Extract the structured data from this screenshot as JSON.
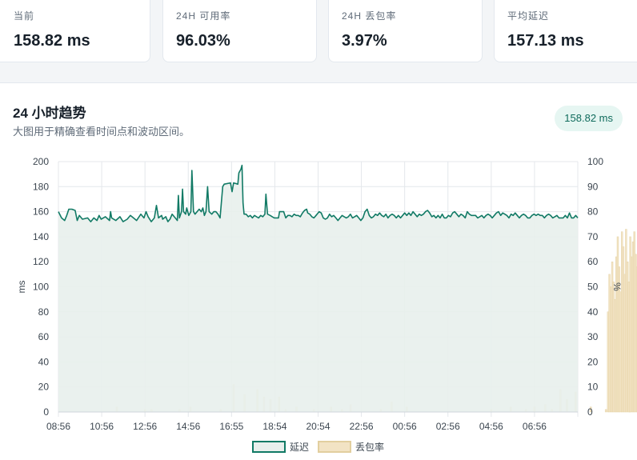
{
  "stats": [
    {
      "label": "当前",
      "value": "158.82 ms"
    },
    {
      "label": "24H 可用率",
      "value": "96.03%"
    },
    {
      "label": "24H 丢包率",
      "value": "3.97%"
    },
    {
      "label": "平均延迟",
      "value": "157.13 ms"
    }
  ],
  "trend": {
    "title": "24 小时趋势",
    "subtitle": "大图用于精确查看时间点和波动区间。",
    "current_badge": "158.82 ms"
  },
  "colors": {
    "latency": "#117a65",
    "latency_fill": "#e8efec",
    "loss": "#f2e3c4",
    "loss_stroke": "#e2cf9f"
  },
  "chart_data": {
    "type": "line",
    "x_ticks": [
      "08:56",
      "10:56",
      "12:56",
      "14:56",
      "16:55",
      "18:54",
      "20:54",
      "22:56",
      "00:56",
      "02:56",
      "04:56",
      "06:56"
    ],
    "y_left": {
      "label": "ms",
      "min": 0,
      "max": 200,
      "ticks": [
        0,
        20,
        40,
        60,
        80,
        100,
        120,
        140,
        160,
        180,
        200
      ]
    },
    "y_right": {
      "label": "%",
      "min": 0,
      "max": 100,
      "ticks": [
        0,
        10,
        20,
        30,
        40,
        50,
        60,
        70,
        80,
        90,
        100
      ]
    },
    "legend": {
      "position": "bottom",
      "items": [
        "延迟",
        "丢包率"
      ]
    },
    "grid": true,
    "x_hours_span": 24,
    "series": [
      {
        "name": "延迟",
        "axis": "left",
        "style": "line-area",
        "points": [
          [
            0,
            160
          ],
          [
            0.3,
            155
          ],
          [
            0.6,
            153
          ],
          [
            0.8,
            157
          ],
          [
            1.0,
            162
          ],
          [
            1.3,
            162
          ],
          [
            1.6,
            161
          ],
          [
            1.8,
            153
          ],
          [
            2.0,
            157
          ],
          [
            2.3,
            154
          ],
          [
            2.8,
            155
          ],
          [
            3.1,
            152
          ],
          [
            3.4,
            155
          ],
          [
            3.7,
            153
          ],
          [
            3.9,
            157
          ],
          [
            4.1,
            154
          ],
          [
            4.5,
            156
          ],
          [
            4.9,
            153
          ],
          [
            5.0,
            160
          ],
          [
            5.1,
            155
          ],
          [
            5.5,
            153
          ],
          [
            5.9,
            156
          ],
          [
            6.2,
            152
          ],
          [
            6.6,
            154
          ],
          [
            6.9,
            157
          ],
          [
            7.2,
            155
          ],
          [
            7.5,
            153
          ],
          [
            7.9,
            158
          ],
          [
            8.2,
            155
          ],
          [
            8.4,
            160
          ],
          [
            8.6,
            156
          ],
          [
            8.9,
            152
          ],
          [
            9.2,
            155
          ],
          [
            9.4,
            165
          ],
          [
            9.6,
            155
          ],
          [
            9.9,
            157
          ],
          [
            10.0,
            154
          ],
          [
            10.3,
            156
          ],
          [
            10.5,
            152
          ],
          [
            10.7,
            154
          ],
          [
            10.9,
            158
          ],
          [
            11.2,
            155
          ],
          [
            11.4,
            153
          ],
          [
            11.5,
            173
          ],
          [
            11.6,
            155
          ],
          [
            11.8,
            160
          ],
          [
            11.9,
            178
          ],
          [
            12.0,
            160
          ],
          [
            12.2,
            158
          ],
          [
            12.3,
            163
          ],
          [
            12.5,
            157
          ],
          [
            12.7,
            160
          ],
          [
            12.8,
            193
          ],
          [
            12.95,
            160
          ],
          [
            13.1,
            158
          ],
          [
            13.3,
            160
          ],
          [
            13.5,
            162
          ],
          [
            13.7,
            160
          ],
          [
            13.85,
            163
          ],
          [
            14.0,
            157
          ],
          [
            14.15,
            160
          ],
          [
            14.3,
            180
          ],
          [
            14.45,
            160
          ],
          [
            14.7,
            158
          ],
          [
            14.9,
            160
          ],
          [
            15.1,
            160
          ],
          [
            15.3,
            158
          ],
          [
            15.5,
            155
          ],
          [
            15.75,
            180
          ],
          [
            15.9,
            182
          ],
          [
            16.5,
            183
          ],
          [
            16.65,
            176
          ],
          [
            16.8,
            183
          ],
          [
            17.2,
            182
          ],
          [
            17.3,
            191
          ],
          [
            17.5,
            194
          ],
          [
            17.6,
            197
          ],
          [
            17.7,
            167
          ],
          [
            17.8,
            158
          ],
          [
            18.0,
            158
          ],
          [
            18.2,
            156
          ],
          [
            18.4,
            157
          ],
          [
            18.6,
            155
          ],
          [
            18.8,
            157
          ],
          [
            19.0,
            156
          ],
          [
            19.2,
            155
          ],
          [
            19.4,
            157
          ],
          [
            19.6,
            156
          ],
          [
            19.8,
            158
          ],
          [
            19.9,
            174
          ],
          [
            20.05,
            158
          ],
          [
            20.3,
            157
          ],
          [
            20.5,
            156
          ],
          [
            20.7,
            155
          ],
          [
            21.1,
            155
          ],
          [
            21.2,
            160
          ],
          [
            21.4,
            160
          ],
          [
            21.6,
            160
          ],
          [
            21.8,
            155
          ],
          [
            22.0,
            157
          ],
          [
            22.2,
            157
          ],
          [
            22.4,
            156
          ],
          [
            22.6,
            158
          ],
          [
            22.8,
            157
          ],
          [
            23.0,
            157
          ],
          [
            23.2,
            156
          ],
          [
            23.4,
            159
          ],
          [
            23.6,
            161
          ],
          [
            23.8,
            162
          ],
          [
            23.9,
            159
          ],
          [
            24.1,
            158
          ],
          [
            24.3,
            156
          ],
          [
            24.5,
            155
          ],
          [
            24.7,
            157
          ],
          [
            24.8,
            158
          ],
          [
            25.0,
            160
          ],
          [
            25.2,
            159
          ],
          [
            25.4,
            155
          ],
          [
            25.6,
            154
          ],
          [
            25.8,
            155
          ],
          [
            26.0,
            158
          ],
          [
            26.2,
            156
          ],
          [
            26.4,
            157
          ],
          [
            26.6,
            155
          ],
          [
            26.8,
            153
          ],
          [
            27.0,
            155
          ],
          [
            27.2,
            157
          ],
          [
            27.4,
            156
          ],
          [
            27.6,
            155
          ],
          [
            27.8,
            156
          ],
          [
            28.0,
            158
          ],
          [
            28.2,
            155
          ],
          [
            28.4,
            156
          ],
          [
            28.6,
            157
          ],
          [
            28.8,
            155
          ],
          [
            29.0,
            153
          ],
          [
            29.2,
            155
          ],
          [
            29.4,
            160
          ],
          [
            29.6,
            162
          ],
          [
            29.8,
            157
          ],
          [
            30.0,
            155
          ],
          [
            30.2,
            156
          ],
          [
            30.4,
            158
          ],
          [
            30.6,
            157
          ],
          [
            30.8,
            159
          ],
          [
            31.0,
            157
          ],
          [
            31.2,
            156
          ],
          [
            31.4,
            158
          ],
          [
            31.6,
            155
          ],
          [
            31.8,
            157
          ],
          [
            32.0,
            158
          ],
          [
            32.2,
            157
          ],
          [
            32.4,
            155
          ],
          [
            32.6,
            157
          ],
          [
            32.8,
            155
          ],
          [
            33.0,
            157
          ],
          [
            33.2,
            159
          ],
          [
            33.4,
            157
          ],
          [
            33.6,
            159
          ],
          [
            33.8,
            157
          ],
          [
            34.0,
            160
          ],
          [
            34.2,
            158
          ],
          [
            34.4,
            156
          ],
          [
            34.6,
            158
          ],
          [
            34.8,
            157
          ],
          [
            35.0,
            158
          ],
          [
            35.2,
            160
          ],
          [
            35.4,
            161
          ],
          [
            35.6,
            159
          ],
          [
            35.8,
            156
          ],
          [
            36.0,
            157
          ],
          [
            36.2,
            155
          ],
          [
            36.4,
            157
          ],
          [
            36.6,
            155
          ],
          [
            36.8,
            158
          ],
          [
            37.0,
            155
          ],
          [
            37.2,
            155
          ],
          [
            37.4,
            157
          ],
          [
            37.6,
            156
          ],
          [
            37.8,
            159
          ],
          [
            38.0,
            160
          ],
          [
            38.2,
            158
          ],
          [
            38.4,
            156
          ],
          [
            38.6,
            158
          ],
          [
            38.8,
            157
          ],
          [
            39.0,
            155
          ],
          [
            39.2,
            160
          ],
          [
            39.4,
            158
          ],
          [
            39.6,
            157
          ],
          [
            39.8,
            157
          ],
          [
            40.0,
            157
          ],
          [
            40.2,
            155
          ],
          [
            40.4,
            156
          ],
          [
            40.6,
            157
          ],
          [
            40.8,
            155
          ],
          [
            41.0,
            157
          ],
          [
            41.2,
            158
          ],
          [
            41.4,
            157
          ],
          [
            41.6,
            155
          ],
          [
            41.8,
            157
          ],
          [
            42.0,
            159
          ],
          [
            42.2,
            160
          ],
          [
            42.4,
            157
          ],
          [
            42.6,
            159
          ],
          [
            42.8,
            158
          ],
          [
            43.0,
            157
          ],
          [
            43.2,
            155
          ],
          [
            43.4,
            158
          ],
          [
            43.6,
            157
          ],
          [
            43.8,
            159
          ],
          [
            44.0,
            157
          ],
          [
            44.2,
            155
          ],
          [
            44.4,
            157
          ],
          [
            44.6,
            158
          ],
          [
            44.8,
            157
          ],
          [
            45.0,
            155
          ],
          [
            45.2,
            155
          ],
          [
            45.4,
            157
          ],
          [
            45.6,
            158
          ],
          [
            45.8,
            157
          ],
          [
            46.0,
            158
          ],
          [
            46.2,
            157
          ],
          [
            46.4,
            157
          ],
          [
            46.6,
            155
          ],
          [
            46.8,
            157
          ],
          [
            47.0,
            158
          ],
          [
            47.2,
            157
          ],
          [
            47.4,
            155
          ],
          [
            47.6,
            156
          ],
          [
            47.8,
            157
          ],
          [
            48.0,
            155
          ],
          [
            48.2,
            155
          ],
          [
            48.4,
            155
          ],
          [
            48.6,
            157
          ],
          [
            48.8,
            155
          ],
          [
            49.0,
            159
          ],
          [
            49.2,
            155
          ],
          [
            49.4,
            155
          ],
          [
            49.6,
            157
          ],
          [
            49.8,
            155
          ]
        ]
      },
      {
        "name": "丢包率",
        "axis": "right",
        "style": "bars",
        "points": [
          [
            2.7,
            2
          ],
          [
            4.0,
            1
          ],
          [
            4.3,
            1
          ],
          [
            5.6,
            1
          ],
          [
            6.1,
            2
          ],
          [
            7.5,
            1
          ],
          [
            8.1,
            11
          ],
          [
            8.6,
            7
          ],
          [
            9.2,
            9
          ],
          [
            9.5,
            6
          ],
          [
            9.8,
            5
          ],
          [
            10.2,
            6
          ],
          [
            10.5,
            1
          ],
          [
            11.0,
            2
          ],
          [
            11.8,
            1
          ],
          [
            12.6,
            2
          ],
          [
            13.1,
            1
          ],
          [
            13.5,
            3
          ],
          [
            14.9,
            1
          ],
          [
            15.4,
            4
          ],
          [
            16.1,
            2
          ],
          [
            20.0,
            1
          ],
          [
            20.9,
            2
          ],
          [
            21.6,
            1
          ],
          [
            22.0,
            2
          ],
          [
            22.5,
            3
          ],
          [
            22.8,
            1
          ],
          [
            23.2,
            9
          ],
          [
            23.5,
            5
          ],
          [
            23.9,
            8
          ],
          [
            24.6,
            2
          ],
          [
            25.3,
            1
          ],
          [
            26.4,
            1
          ],
          [
            27.1,
            1
          ],
          [
            27.8,
            1
          ],
          [
            28.2,
            1
          ],
          [
            28.7,
            9
          ],
          [
            29.4,
            2
          ],
          [
            30.5,
            1
          ],
          [
            31.6,
            3
          ],
          [
            33.3,
            1
          ],
          [
            34.0,
            1
          ],
          [
            35.1,
            1
          ],
          [
            35.6,
            1
          ],
          [
            37.2,
            8
          ],
          [
            38.0,
            1
          ],
          [
            38.9,
            1
          ],
          [
            40.7,
            1
          ],
          [
            41.5,
            2
          ],
          [
            42.6,
            8
          ],
          [
            43.1,
            1
          ],
          [
            44.0,
            1
          ],
          [
            45.1,
            1
          ],
          [
            46.8,
            1
          ],
          [
            47.3,
            1
          ],
          [
            48.6,
            1
          ],
          [
            49.7,
            8
          ]
        ]
      }
    ],
    "loss_burst": {
      "from_hour": 25.4,
      "to_hour": 27.9,
      "values_pct": [
        40,
        55,
        50,
        60,
        52,
        45,
        62,
        70,
        58,
        48,
        72,
        66,
        55,
        73,
        60,
        52,
        70,
        62,
        68,
        72,
        63,
        58,
        74,
        69,
        61,
        73,
        67,
        59,
        72,
        68,
        63,
        55,
        71,
        66,
        70,
        62,
        58,
        64,
        68,
        60
      ]
    }
  }
}
